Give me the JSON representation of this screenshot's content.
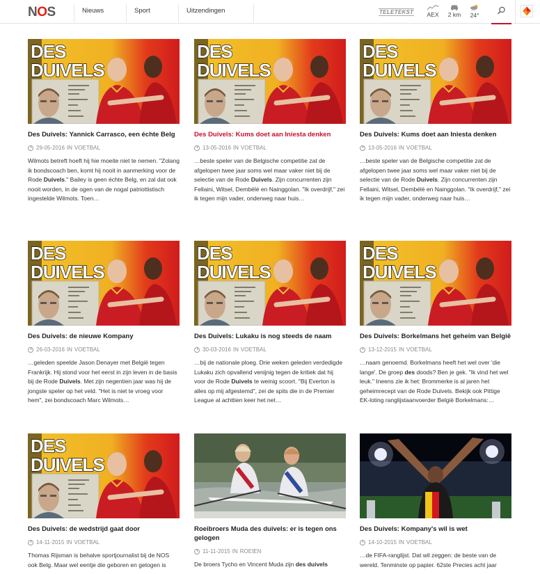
{
  "header": {
    "logo": {
      "text_n": "N",
      "text_o": "O",
      "text_s": "S"
    },
    "nav": [
      {
        "label": "Nieuws"
      },
      {
        "label": "Sport"
      },
      {
        "label": "Uitzendingen"
      }
    ],
    "teletekst": "TELETEKST",
    "widgets": {
      "aex_label": "AEX",
      "traffic_label": "2 km",
      "weather_label": "24°"
    },
    "accent_color": "#e61e14",
    "active_underline_color": "#c8102e"
  },
  "articles": [
    {
      "title": "Des Duivels: Yannick Carrasco, een échte Belg",
      "date": "29-05-2016",
      "in": "in",
      "category": "Voetbal",
      "excerpt_before": "Wilmots betreft hoeft hij hie moeite niet te nemen. \"Zolang ik bondscoach ben, komt hij nooit in aanmerking voor de Rode ",
      "excerpt_bold": "Duivels",
      "excerpt_after": ".\" Bailey is geen échte Belg, en zal dat ook nooit worden, in de ogen van de nogal patriottistisch ingestelde Wilmots. Toen…",
      "image": "des-duivels-banner",
      "active": false
    },
    {
      "title": "Des Duivels: Kums doet aan Iniesta denken",
      "date": "13-05-2016",
      "in": "in",
      "category": "Voetbal",
      "excerpt_before": "…beste speler van de Belgische competitie zat de afgelopen twee jaar soms wel maar vaker niet bij de selectie van de Rode ",
      "excerpt_bold": "Duivels",
      "excerpt_after": ". Zijn concurrenten zijn Fellaini, Witsel, Dembélé en Nainggolan. \"Ik overdrijf,\" zei ik tegen mijn vader, onderweg naar huis…",
      "image": "des-duivels-banner",
      "active": true
    },
    {
      "title": "Des Duivels: Kums doet aan Iniesta denken",
      "date": "13-05-2016",
      "in": "in",
      "category": "Voetbal",
      "excerpt_before": "…beste speler van de Belgische competitie zat de afgelopen twee jaar soms wel maar vaker niet bij de selectie van de Rode ",
      "excerpt_bold": "Duivels",
      "excerpt_after": ". Zijn concurrenten zijn Fellaini, Witsel, Dembélé en Nainggolan. \"Ik overdrijf,\" zei ik tegen mijn vader, onderweg naar huis…",
      "image": "des-duivels-banner",
      "active": false
    },
    {
      "title": "Des Duivels: de nieuwe Kompany",
      "date": "26-03-2016",
      "in": "in",
      "category": "Voetbal",
      "excerpt_before": "…geleden speelde Jason Denayer met België tegen Frankrijk. Hij stond voor het eerst in zijn leven in de basis bij de Rode ",
      "excerpt_bold": "Duivels",
      "excerpt_after": ". Met zijn negentien jaar was hij de jongste speler op het veld. \"Het is niet te vroeg voor hem\", zei bondscoach Marc Wilmots…",
      "image": "des-duivels-banner",
      "active": false
    },
    {
      "title": "Des Duivels: Lukaku is nog steeds de naam",
      "date": "30-03-2016",
      "in": "in",
      "category": "Voetbal",
      "excerpt_before": "…bij de nationale ploeg. Drie weken geleden verdedigde Lukaku zich opvallend venijnig tegen de kritiek dat hij voor de Rode ",
      "excerpt_bold": "Duivels",
      "excerpt_after": " te weinig scoort. \"Bij Everton is alles op mij afgestemd\", zei de spits die in de Premier League al achttien keer het net…",
      "image": "des-duivels-banner",
      "active": false
    },
    {
      "title": "Des Duivels: Borkelmans het geheim van België",
      "date": "13-12-2015",
      "in": "in",
      "category": "Voetbal",
      "excerpt_before": "…naam genoemd. Borkelmans heeft het wel over 'die lange'. De groep ",
      "excerpt_bold": "des",
      "excerpt_after": " doods? Ben je gek. \"Ik vind het wel leuk.\" Ineens zie ik het: Brommerke is al jaren het geheimrecept van de Rode Duivels. Bekijk ook Pittige EK-loting ranglijstaanvoerder België Borkelmans:…",
      "image": "des-duivels-banner",
      "active": false
    },
    {
      "title": "Des Duivels: de wedstrijd gaat door",
      "date": "14-11-2015",
      "in": "in",
      "category": "Voetbal",
      "excerpt_before": "Thomas Rijsman is behalve sportjournalist bij de NOS ook Belg. Maar wel eentje die geboren en getogen is",
      "excerpt_bold": "",
      "excerpt_after": "",
      "image": "des-duivels-banner",
      "active": false
    },
    {
      "title": "Roeibroers Muda des duivels: er is tegen ons gelogen",
      "date": "11-11-2015",
      "in": "in",
      "category": "Roeien",
      "excerpt_before": "De broers Tycho en Vincent Muda zijn ",
      "excerpt_bold": "des duivels",
      "excerpt_after": "",
      "image": "rowing-photo",
      "active": false
    },
    {
      "title": "Des Duivels: Kompany's wil is wet",
      "date": "14-10-2015",
      "in": "in",
      "category": "Voetbal",
      "excerpt_before": "…de FIFA-ranglijst. Dat wil zeggen: de beste van de wereld. Tenminste op papier. 62ste Precies acht jaar",
      "excerpt_bold": "",
      "excerpt_after": "",
      "image": "stadium-celebration-photo",
      "active": false
    }
  ]
}
